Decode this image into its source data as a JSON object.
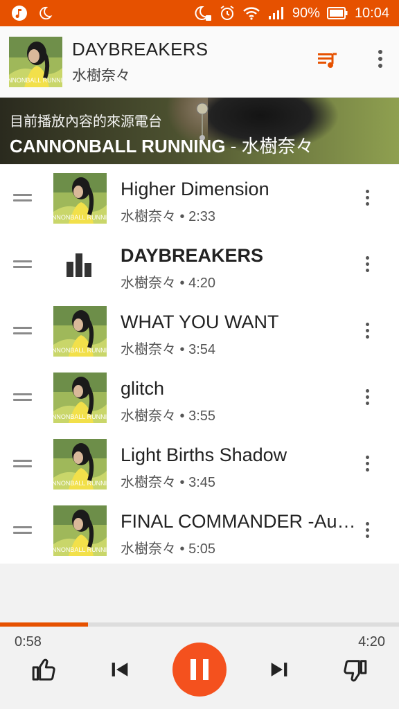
{
  "status_bar": {
    "battery": "90%",
    "time": "10:04",
    "left_icons": [
      "music-notification-icon",
      "moon-icon"
    ],
    "right_icons": [
      "do-not-disturb-moon-icon",
      "alarm-icon",
      "wifi-icon",
      "signal-icon",
      "battery-icon"
    ]
  },
  "now_playing": {
    "title": "DAYBREAKERS",
    "artist": "水樹奈々",
    "art_caption": "CANNONBALL RUNNING"
  },
  "radio_source": {
    "label": "目前播放內容的來源電台",
    "album": "CANNONBALL RUNNING",
    "separator": " - ",
    "artist": "水樹奈々"
  },
  "tracks": [
    {
      "title": "Higher Dimension",
      "meta": "水樹奈々 • 2:33",
      "playing": false
    },
    {
      "title": "DAYBREAKERS",
      "meta": "水樹奈々 • 4:20",
      "playing": true
    },
    {
      "title": "WHAT YOU WANT",
      "meta": "水樹奈々 • 3:54",
      "playing": false
    },
    {
      "title": "glitch",
      "meta": "水樹奈々 • 3:55",
      "playing": false
    },
    {
      "title": "Light Births Shadow",
      "meta": "水樹奈々 • 3:45",
      "playing": false
    },
    {
      "title": "FINAL COMMANDER -Au…",
      "meta": "水樹奈々 • 5:05",
      "playing": false
    }
  ],
  "player": {
    "elapsed": "0:58",
    "duration": "4:20",
    "progress_fraction": 0.22,
    "accent_color": "#e65100",
    "play_button_color": "#f4511e"
  }
}
